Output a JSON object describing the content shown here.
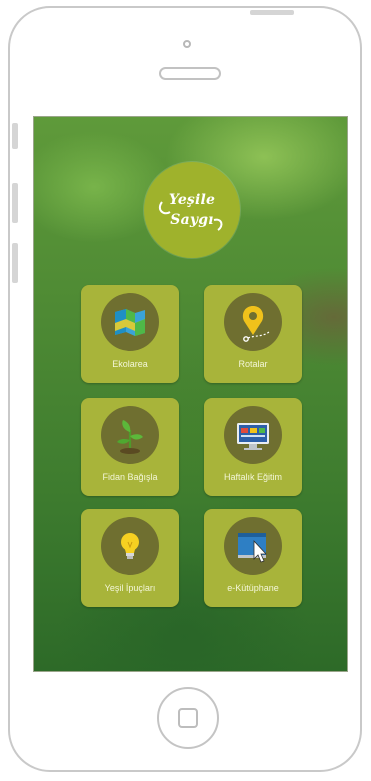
{
  "app": {
    "logo_line1": "Yeşile",
    "logo_line2": "Saygı"
  },
  "menu": [
    {
      "label": "Ekolarea",
      "icon": "map-icon"
    },
    {
      "label": "Rotalar",
      "icon": "location-pin-icon"
    },
    {
      "label": "Fidan Bağışla",
      "icon": "seedling-icon"
    },
    {
      "label": "Haftalık Eğitim",
      "icon": "monitor-icon"
    },
    {
      "label": "Yeşil İpuçları",
      "icon": "lightbulb-icon"
    },
    {
      "label": "e-Kütüphane",
      "icon": "ebook-cursor-icon"
    }
  ],
  "colors": {
    "tile": "#a8b43a",
    "badge": "#6f6f30",
    "logo": "#9fb22c",
    "background": "#3f7d2f"
  }
}
